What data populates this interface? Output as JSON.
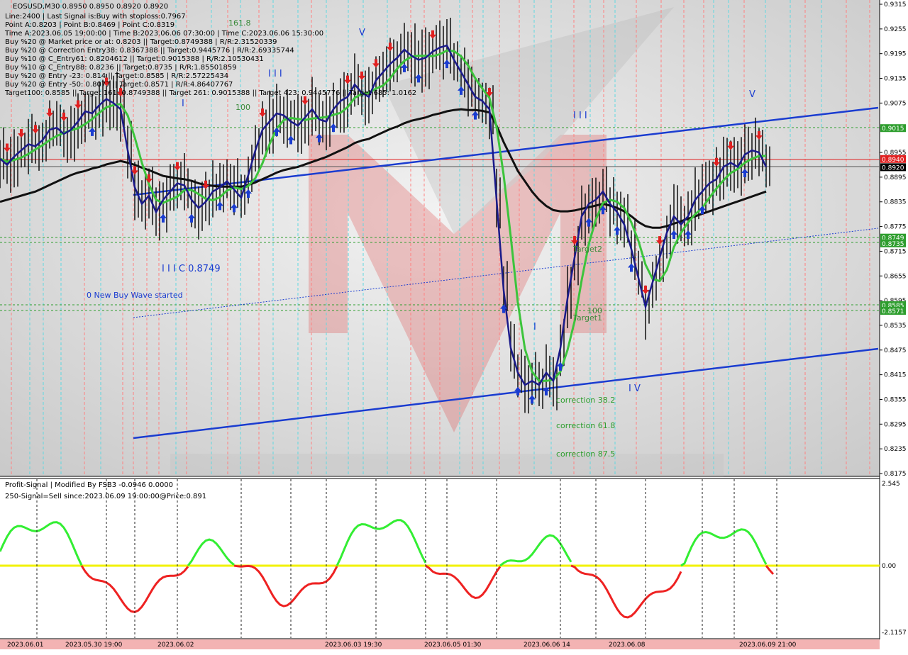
{
  "header": {
    "symbol_line": "EOSUSD,M30  0.8950 0.8950 0.8920 0.8920",
    "info_lines": [
      "Line:2400 | Last Signal is:Buy with stoploss:0.7967",
      "Point A:0.8203 | Point B:0.8469 | Point C:0.8319",
      "Time A:2023.06.05 19:00:00 | Time B:2023.06.06 07:30:00 | Time C:2023.06.06 15:30:00",
      "Buy %20 @ Market price or at: 0.8203 || Target:0.8749388 | R/R:2.31520339",
      "Buy %20 @ Correction Entry38: 0.8367388 || Target:0.9445776 | R/R:2.69335744",
      "Buy %10 @ C_Entry61: 0.8204612 || Target:0.9015388 | R/R:2.10530431",
      "Buy %10 @ C_Entry88: 0.8236 || Target:0.8735 | R/R:1.85501859",
      "Buy %20 @ Entry -23: 0.814 || Target:0.8585 | R/R:2.57225434",
      "Buy %20 @ Entry -50: 0.8077 || Target:0.8571 | R/R:4.86407767",
      "Target100: 0.8585 || Target 161: 0.8749388 || Target 261: 0.9015388 || Target 423: 0.9445776 || Target 685: 1.0162"
    ]
  },
  "price_axis": [
    "0.9315",
    "0.9255",
    "0.9195",
    "0.9135",
    "0.9075",
    "0.9015",
    "0.8955",
    "0.8895",
    "0.8835",
    "0.8775",
    "0.8715",
    "0.8655",
    "0.8595",
    "0.8535",
    "0.8475",
    "0.8415",
    "0.8355",
    "0.8295",
    "0.8235",
    "0.8175"
  ],
  "price_tags": [
    {
      "label": "0.9015",
      "color": "#2e9e2e"
    },
    {
      "label": "0.8940",
      "color": "#e02020"
    },
    {
      "label": "0.8920",
      "color": "#000000"
    },
    {
      "label": "0.8749",
      "color": "#2e9e2e"
    },
    {
      "label": "0.8735",
      "color": "#2e9e2e"
    },
    {
      "label": "0.8585",
      "color": "#2e9e2e"
    },
    {
      "label": "0.8571",
      "color": "#2e9e2e"
    }
  ],
  "annotations": {
    "wave_labels": [
      "V",
      "I I I",
      "I",
      "I I I",
      "V",
      "I",
      "I V"
    ],
    "c_label": "I I I C 0.8749",
    "new_wave": "0 New Buy Wave started",
    "fib_161": "161.8",
    "fib_100_top": "100",
    "fib_100_mid": "100",
    "target2": "Target2",
    "target1": "Target1",
    "corr_382": "correction 38.2",
    "corr_618": "correction 61.8",
    "corr_875": "correction 87.5"
  },
  "indicator": {
    "title": "Profit-Signal | Modified By FSB3 -0.0946 0.0000",
    "signal_line": "250-Signal=Sell since:2023.06.09 19:00:00@Price:0.891",
    "axis": [
      "2.545",
      "0.00",
      "-2.1157"
    ]
  },
  "time_axis": [
    "2023.06.01",
    "2023.05.30 19:00",
    "2023.06.02",
    "2023.06.03 19:30",
    "2023.06.05 01:30",
    "2023.06.06 14",
    "2023.06.08",
    "2023.06.09 21:00"
  ],
  "colors": {
    "bull": "#2e9e2e",
    "bear": "#e02020",
    "channel": "#1a3cd0",
    "ma_long": "#111111",
    "ma_green": "#3cc43c",
    "signal_zero": "#f2f200"
  },
  "chart_data": {
    "type": "line",
    "title": "EOSUSD,M30",
    "x": [
      0,
      10,
      20,
      30,
      40,
      50,
      60,
      70,
      80,
      90,
      100,
      110,
      120,
      130,
      140,
      150,
      160,
      170,
      180,
      190,
      200,
      210,
      220,
      230,
      240,
      250,
      260,
      270,
      280,
      290,
      300,
      310,
      320,
      330,
      340,
      350,
      360,
      370,
      380,
      390,
      400,
      410,
      420,
      430,
      440,
      450,
      460,
      470,
      480,
      490,
      500,
      510,
      520,
      530,
      540,
      550,
      560,
      570,
      580,
      590,
      600,
      610,
      620,
      630,
      640,
      650,
      660,
      670,
      680,
      690,
      700,
      710,
      720,
      730,
      740,
      750,
      760,
      770,
      780,
      790,
      800,
      810,
      820,
      830,
      840,
      850,
      860,
      870,
      880,
      890,
      900,
      910,
      920,
      930,
      940,
      950,
      960,
      970,
      980,
      990,
      1000,
      1010,
      1020,
      1030,
      1040,
      1050,
      1060,
      1070,
      1080
    ],
    "series": [
      {
        "values": [
          0.894,
          0.8925,
          0.8945,
          0.896,
          0.8975,
          0.897,
          0.8985,
          0.901,
          0.9015,
          0.9,
          0.901,
          0.903,
          0.9055,
          0.905,
          0.907,
          0.9085,
          0.9075,
          0.906,
          0.896,
          0.887,
          0.883,
          0.885,
          0.881,
          0.884,
          0.886,
          0.888,
          0.8875,
          0.884,
          0.882,
          0.8835,
          0.886,
          0.887,
          0.8885,
          0.8865,
          0.8845,
          0.89,
          0.896,
          0.901,
          0.903,
          0.905,
          0.9045,
          0.903,
          0.902,
          0.904,
          0.906,
          0.9035,
          0.903,
          0.906,
          0.908,
          0.909,
          0.912,
          0.91,
          0.909,
          0.913,
          0.915,
          0.917,
          0.9185,
          0.9205,
          0.919,
          0.918,
          0.9185,
          0.92,
          0.921,
          0.9215,
          0.918,
          0.915,
          0.912,
          0.909,
          0.908,
          0.906,
          0.884,
          0.862,
          0.848,
          0.842,
          0.839,
          0.84,
          0.839,
          0.842,
          0.84,
          0.848,
          0.86,
          0.87,
          0.88,
          0.883,
          0.884,
          0.886,
          0.883,
          0.881,
          0.878,
          0.872,
          0.865,
          0.858,
          0.864,
          0.87,
          0.876,
          0.88,
          0.878,
          0.88,
          0.884,
          0.886,
          0.888,
          0.889,
          0.892,
          0.893,
          0.892,
          0.895,
          0.896,
          0.8955,
          0.892
        ]
      },
      {
        "values": [
          0.8835,
          0.884,
          0.8845,
          0.885,
          0.8855,
          0.886,
          0.8868,
          0.8876,
          0.8884,
          0.8892,
          0.89,
          0.8906,
          0.891,
          0.8916,
          0.892,
          0.8926,
          0.893,
          0.8934,
          0.893,
          0.8925,
          0.8918,
          0.8912,
          0.8905,
          0.8898,
          0.8895,
          0.8892,
          0.889,
          0.8886,
          0.888,
          0.8876,
          0.8874,
          0.8872,
          0.8872,
          0.8872,
          0.8872,
          0.8876,
          0.8882,
          0.889,
          0.8898,
          0.8906,
          0.8912,
          0.8916,
          0.892,
          0.8926,
          0.8932,
          0.8938,
          0.8944,
          0.8952,
          0.896,
          0.8968,
          0.8978,
          0.8984,
          0.8988,
          0.8996,
          0.9004,
          0.9012,
          0.9018,
          0.9026,
          0.9032,
          0.9036,
          0.904,
          0.9046,
          0.905,
          0.9055,
          0.9058,
          0.906,
          0.9058,
          0.9058,
          0.9056,
          0.9052,
          0.902,
          0.898,
          0.8945,
          0.891,
          0.8885,
          0.886,
          0.884,
          0.8825,
          0.8815,
          0.8812,
          0.8812,
          0.8814,
          0.8818,
          0.8822,
          0.8826,
          0.883,
          0.8826,
          0.882,
          0.8812,
          0.88,
          0.8786,
          0.8776,
          0.8772,
          0.8772,
          0.8776,
          0.8782,
          0.8788,
          0.8794,
          0.88,
          0.8806,
          0.8812,
          0.8818,
          0.8824,
          0.883,
          0.8836,
          0.8842,
          0.8848,
          0.8854,
          0.886
        ]
      }
    ],
    "ylim": [
      0.8175,
      0.9315
    ],
    "grid": true
  }
}
